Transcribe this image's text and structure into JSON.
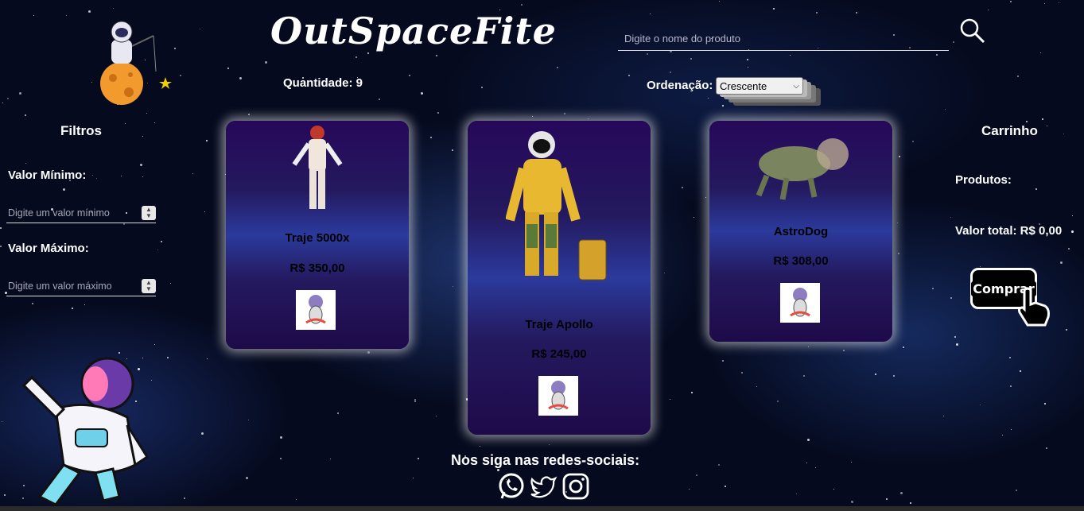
{
  "header": {
    "title": "OutSpaceFite",
    "quantity_label": "Quantidade: 9",
    "search_placeholder": "Digite o nome do produto",
    "sort_label": "Ordenação:",
    "sort_selected": "Crescente"
  },
  "filters": {
    "title": "Filtros",
    "min_label": "Valor Mínimo:",
    "min_placeholder": "Digite um valor mínimo",
    "max_label": "Valor Máximo:",
    "max_placeholder": "Digite um valor máximo"
  },
  "products": [
    {
      "name": "Traje 5000x",
      "price": "R$ 350,00"
    },
    {
      "name": "Traje Apollo",
      "price": "R$ 245,00"
    },
    {
      "name": "AstroDog",
      "price": "R$ 308,00"
    }
  ],
  "cart": {
    "title": "Carrinho",
    "products_label": "Produtos:",
    "total_label": "Valor total: R$ 0,00",
    "buy_label": "Comprar"
  },
  "footer": {
    "follow_text": "Nos siga nas redes-sociais:",
    "social_icons": [
      "whatsapp-icon",
      "twitter-icon",
      "instagram-icon"
    ]
  },
  "colors": {
    "card_top": "#26085a",
    "card_mid": "#2b3a9c",
    "background": "#050a1e"
  }
}
